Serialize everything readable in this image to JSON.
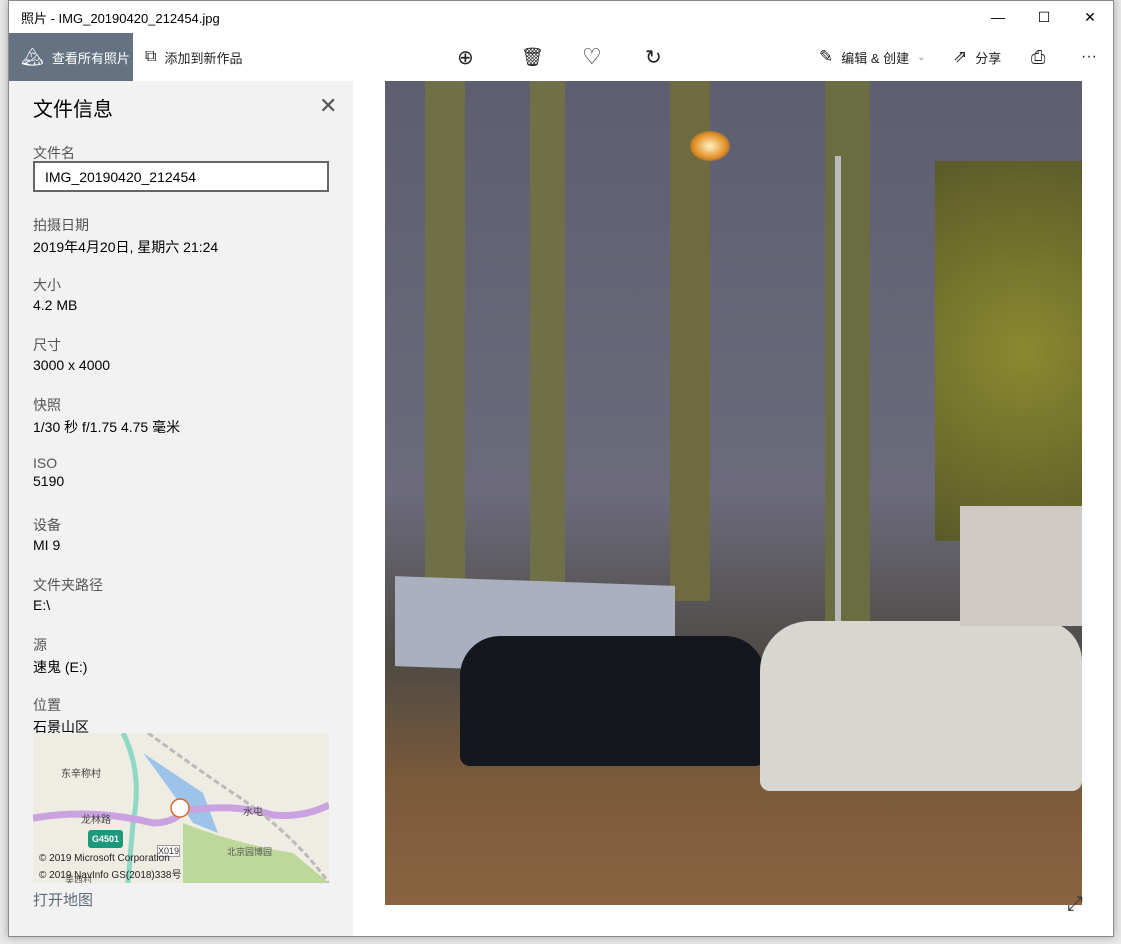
{
  "window": {
    "title": "照片 - IMG_20190420_212454.jpg"
  },
  "toolbar": {
    "all_photos": "查看所有照片",
    "add_to_creation": "添加到新作品",
    "edit_create": "编辑 & 创建",
    "share": "分享"
  },
  "info": {
    "title": "文件信息",
    "filename_label": "文件名",
    "filename": "IMG_20190420_212454",
    "fields": [
      {
        "label": "拍摄日期",
        "value": "2019年4月20日, 星期六 21:24"
      },
      {
        "label": "大小",
        "value": "4.2 MB"
      },
      {
        "label": "尺寸",
        "value": "3000 x 4000"
      },
      {
        "label": "快照",
        "value": "1/30 秒 f/1.75 4.75 毫米"
      },
      {
        "label": "ISO",
        "value": "5190"
      },
      {
        "label": "设备",
        "value": "MI 9"
      },
      {
        "label": "文件夹路径",
        "value": "E:\\"
      },
      {
        "label": "源",
        "value": "速鬼 (E:)"
      },
      {
        "label": "位置",
        "value": "石景山区"
      }
    ],
    "map": {
      "labels": [
        "东辛称村",
        "龙林路",
        "水屯",
        "G4501",
        "X019",
        "北京园博园",
        "吴西村"
      ],
      "copyright1": "© 2019 Microsoft Corporation",
      "copyright2": "© 2019 NavInfo GS(2018)338号"
    },
    "open_map": "打开地图"
  }
}
